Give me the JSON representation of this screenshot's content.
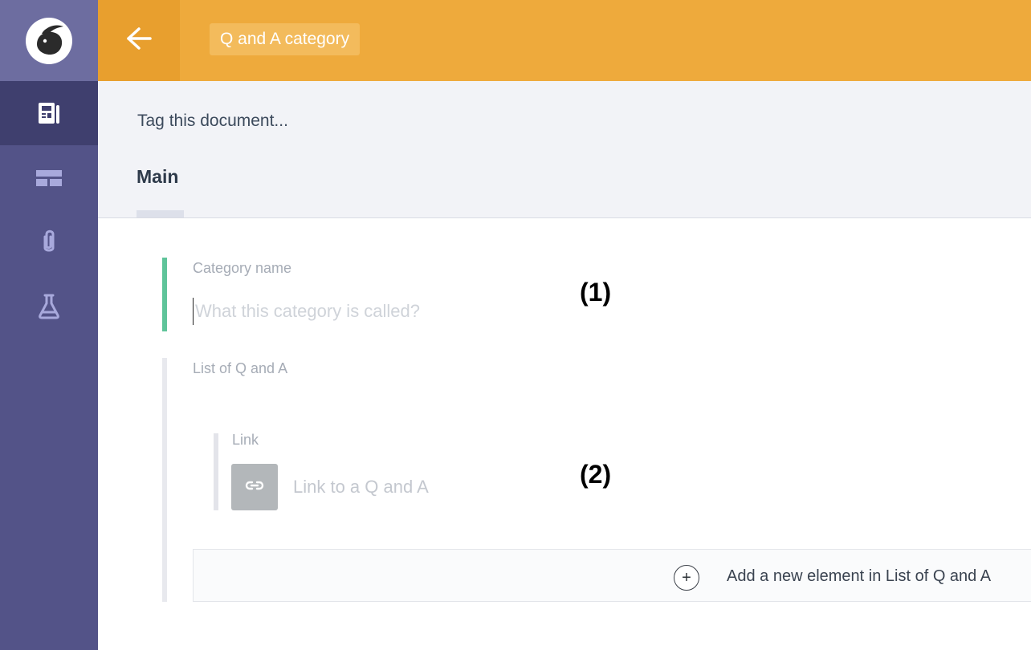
{
  "sidebar": {
    "logo_icon": "rabbit-logo-icon",
    "items": [
      {
        "icon": "document-icon",
        "active": true
      },
      {
        "icon": "slices-icon",
        "active": false
      },
      {
        "icon": "paperclip-icon",
        "active": false
      },
      {
        "icon": "flask-icon",
        "active": false
      }
    ]
  },
  "topbar": {
    "back_icon": "back-arrow-icon",
    "title": "Q and A category"
  },
  "header": {
    "tag_prompt": "Tag this document...",
    "tabs": [
      {
        "label": "Main",
        "active": true
      }
    ]
  },
  "fields": {
    "category_name": {
      "label": "Category name",
      "value": "",
      "placeholder": "What this category is called?"
    },
    "qa_list": {
      "label": "List of Q and A",
      "link": {
        "label": "Link",
        "icon": "link-icon",
        "placeholder": "Link to a Q and A"
      },
      "add_button": {
        "icon": "plus-icon",
        "label": "Add a new element in List of Q and A"
      }
    }
  },
  "annotations": [
    "(1)",
    "(2)"
  ],
  "colors": {
    "sidebar": "#535388",
    "sidebar_active": "#3f3f6e",
    "topbar": "#eeaa3c",
    "field_active": "#5fc49a"
  }
}
